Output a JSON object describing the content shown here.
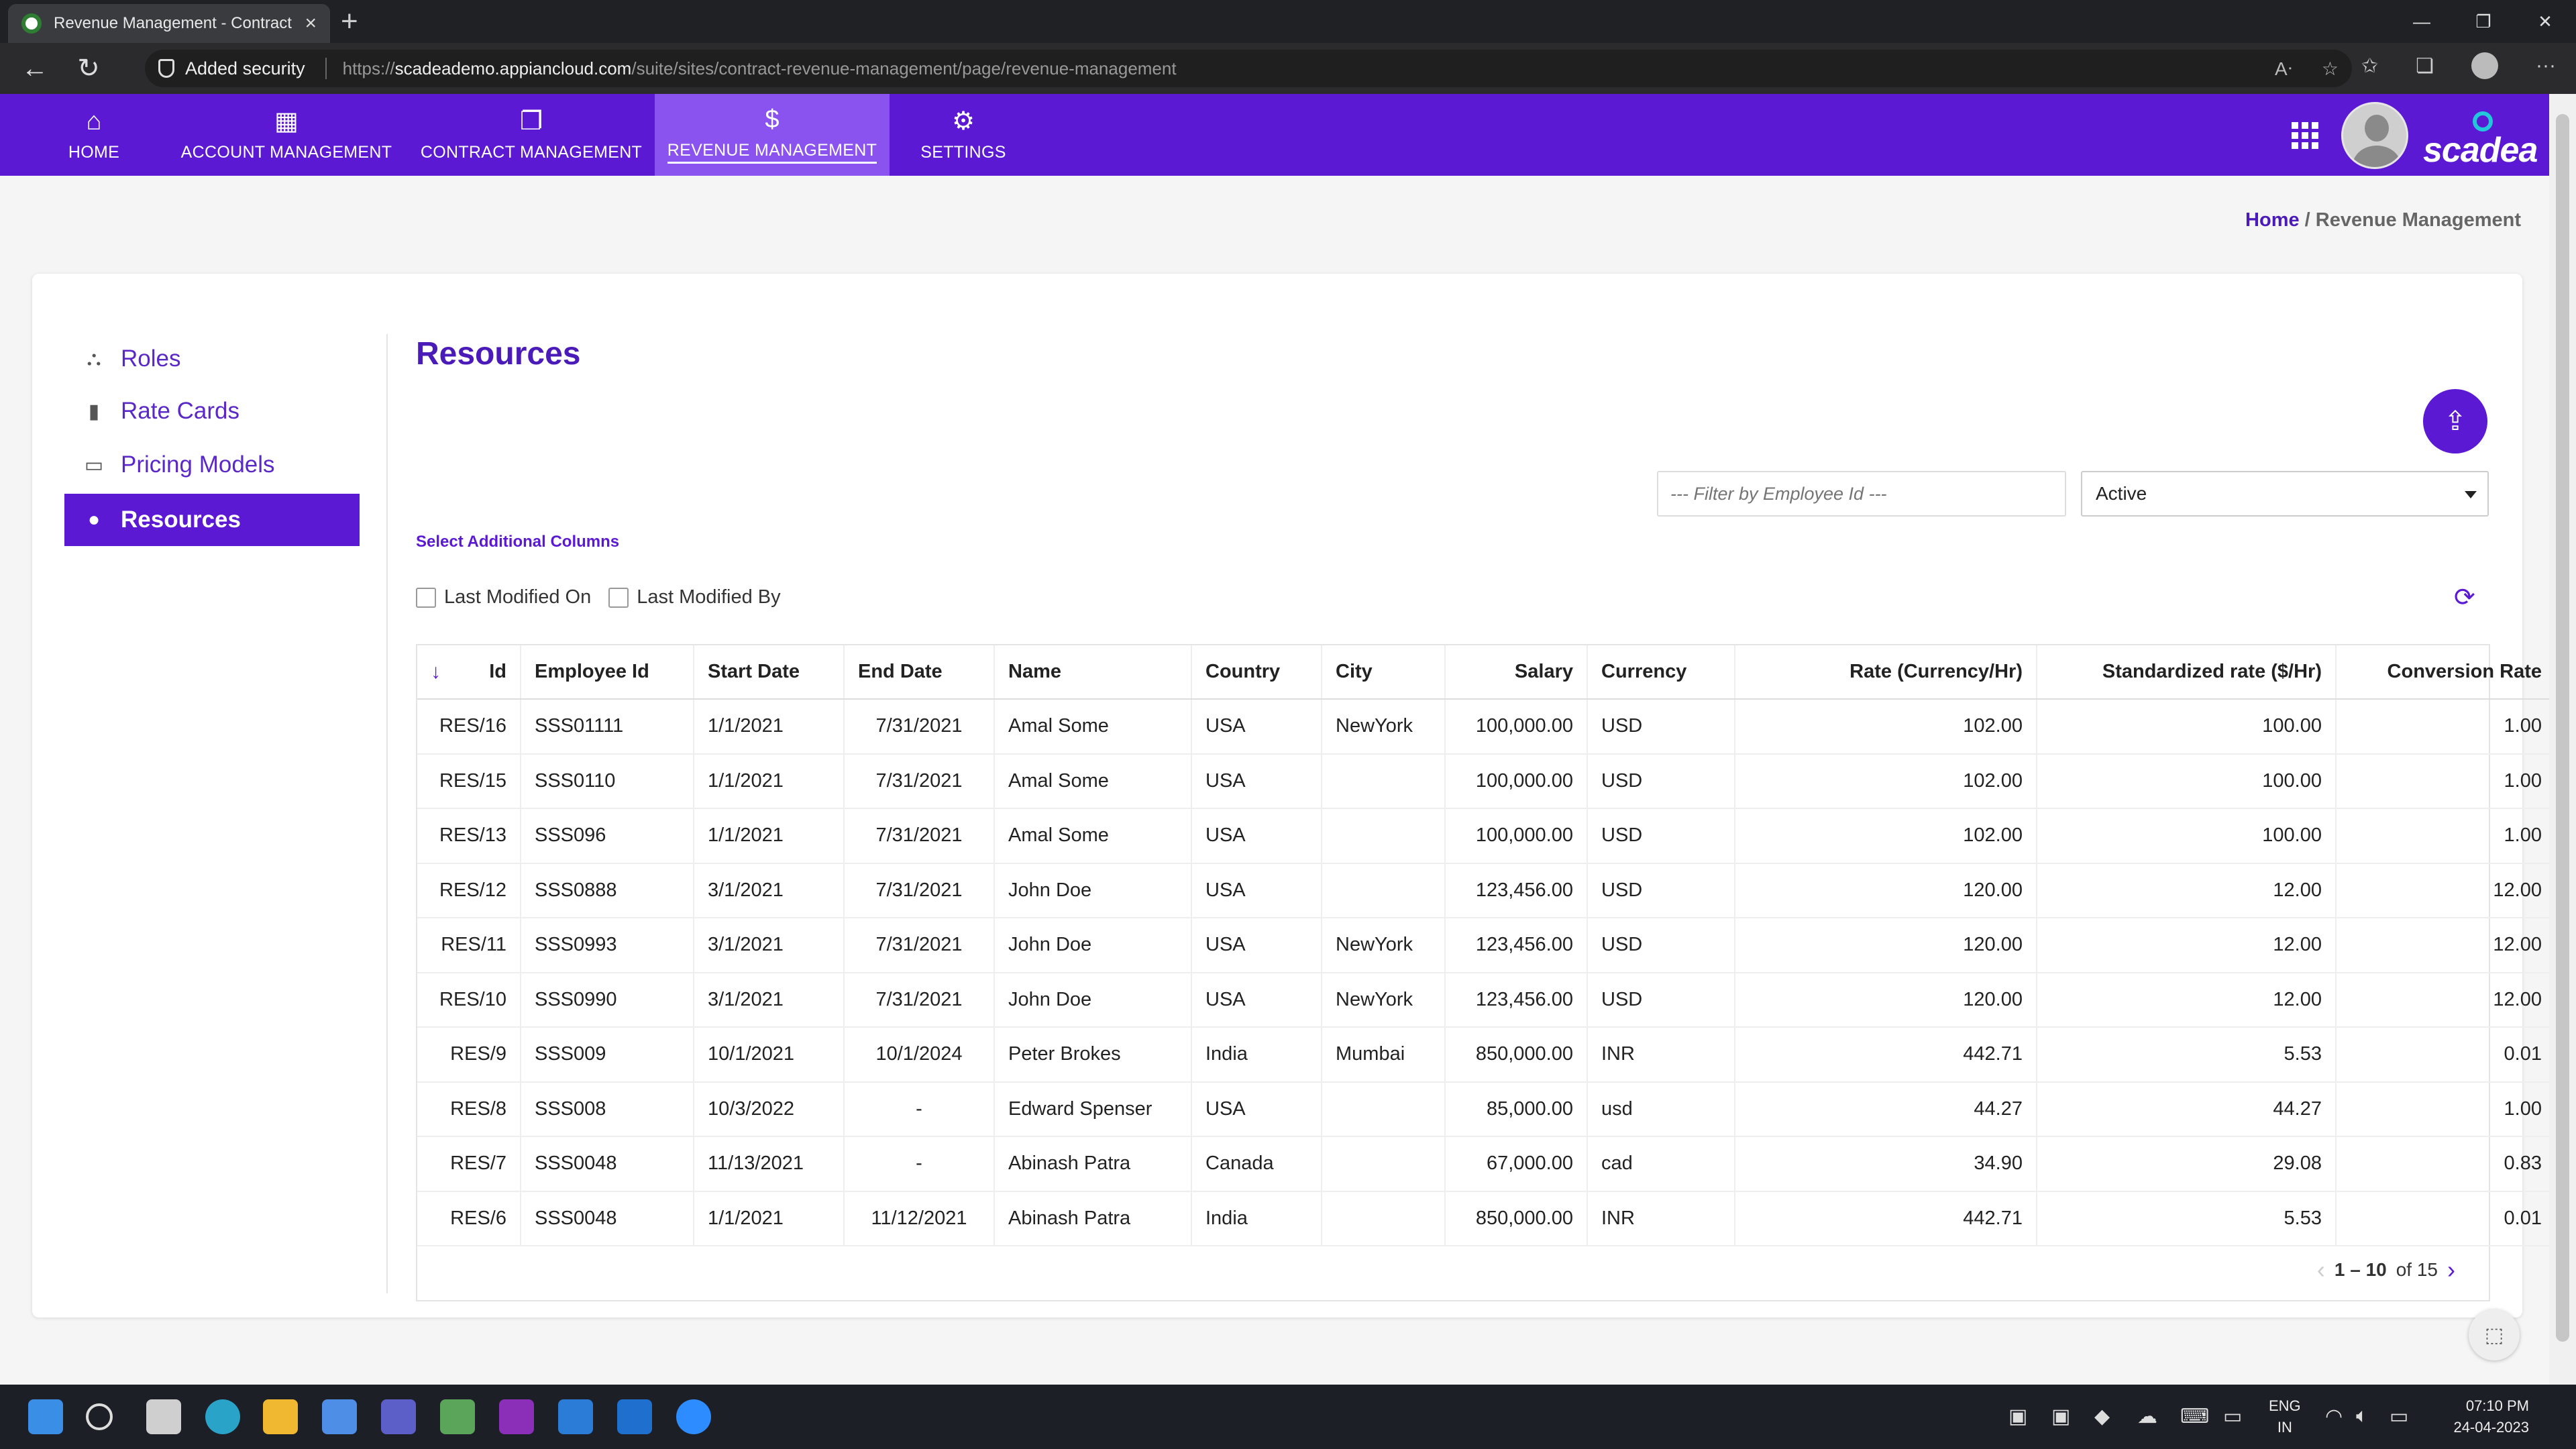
{
  "browser": {
    "tab_title": "Revenue Management - Contract",
    "security_label": "Added security",
    "url_proto": "https://",
    "url_host": "scadeademo.appiancloud.com",
    "url_path": "/suite/sites/contract-revenue-management/page/revenue-management"
  },
  "nav": {
    "items": [
      {
        "label": "HOME",
        "icon": "home-icon"
      },
      {
        "label": "ACCOUNT MANAGEMENT",
        "icon": "building-icon"
      },
      {
        "label": "CONTRACT MANAGEMENT",
        "icon": "documents-icon"
      },
      {
        "label": "REVENUE MANAGEMENT",
        "icon": "dollar-icon",
        "active": true
      },
      {
        "label": "SETTINGS",
        "icon": "gear-icon"
      }
    ],
    "brand": "scadea"
  },
  "breadcrumb": {
    "home": "Home",
    "sep": " / ",
    "current": "Revenue Management"
  },
  "sidebar": {
    "items": [
      {
        "label": "Roles",
        "icon": "hierarchy-icon"
      },
      {
        "label": "Rate Cards",
        "icon": "document-icon"
      },
      {
        "label": "Pricing Models",
        "icon": "money-icon"
      },
      {
        "label": "Resources",
        "icon": "user-icon",
        "active": true
      }
    ]
  },
  "main": {
    "title": "Resources",
    "filter_placeholder": "--- Filter by Employee Id ---",
    "status_value": "Active",
    "additional_columns_label": "Select Additional Columns",
    "checkboxes": [
      "Last Modified On",
      "Last Modified By"
    ]
  },
  "table": {
    "headers": [
      "Id",
      "Employee Id",
      "Start Date",
      "End Date",
      "Name",
      "Country",
      "City",
      "Salary",
      "Currency",
      "Rate (Currency/Hr)",
      "Standardized rate ($/Hr)",
      "Conversion Rate"
    ],
    "rows": [
      [
        "RES/16",
        "SSS01111",
        "1/1/2021",
        "7/31/2021",
        "Amal Some",
        "USA",
        "NewYork",
        "100,000.00",
        "USD",
        "102.00",
        "100.00",
        "1.00"
      ],
      [
        "RES/15",
        "SSS0110",
        "1/1/2021",
        "7/31/2021",
        "Amal Some",
        "USA",
        "",
        "100,000.00",
        "USD",
        "102.00",
        "100.00",
        "1.00"
      ],
      [
        "RES/13",
        "SSS096",
        "1/1/2021",
        "7/31/2021",
        "Amal Some",
        "USA",
        "",
        "100,000.00",
        "USD",
        "102.00",
        "100.00",
        "1.00"
      ],
      [
        "RES/12",
        "SSS0888",
        "3/1/2021",
        "7/31/2021",
        "John Doe",
        "USA",
        "",
        "123,456.00",
        "USD",
        "120.00",
        "12.00",
        "12.00"
      ],
      [
        "RES/11",
        "SSS0993",
        "3/1/2021",
        "7/31/2021",
        "John Doe",
        "USA",
        "NewYork",
        "123,456.00",
        "USD",
        "120.00",
        "12.00",
        "12.00"
      ],
      [
        "RES/10",
        "SSS0990",
        "3/1/2021",
        "7/31/2021",
        "John Doe",
        "USA",
        "NewYork",
        "123,456.00",
        "USD",
        "120.00",
        "12.00",
        "12.00"
      ],
      [
        "RES/9",
        "SSS009",
        "10/1/2021",
        "10/1/2024",
        "Peter Brokes",
        "India",
        "Mumbai",
        "850,000.00",
        "INR",
        "442.71",
        "5.53",
        "0.01"
      ],
      [
        "RES/8",
        "SSS008",
        "10/3/2022",
        "-",
        "Edward Spenser",
        "USA",
        "",
        "85,000.00",
        "usd",
        "44.27",
        "44.27",
        "1.00"
      ],
      [
        "RES/7",
        "SSS0048",
        "11/13/2021",
        "-",
        "Abinash Patra",
        "Canada",
        "",
        "67,000.00",
        "cad",
        "34.90",
        "29.08",
        "0.83"
      ],
      [
        "RES/6",
        "SSS0048",
        "1/1/2021",
        "11/12/2021",
        "Abinash Patra",
        "India",
        "",
        "850,000.00",
        "INR",
        "442.71",
        "5.53",
        "0.01"
      ]
    ],
    "pager": {
      "range": "1 – 10",
      "of": "of 15"
    }
  },
  "taskbar": {
    "lang_top": "ENG",
    "lang_bottom": "IN",
    "time": "07:10 PM",
    "date": "24-04-2023"
  },
  "colors": {
    "brand": "#5b19d4",
    "brand_active": "#8a52ee",
    "link": "#4a1bb8"
  }
}
